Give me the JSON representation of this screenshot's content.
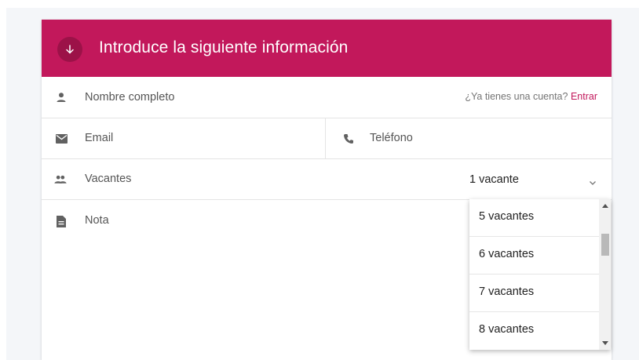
{
  "form": {
    "header_title": "Introduce la siguiente información",
    "header_icon": "arrow-down-icon",
    "accent_color": "#c2185b",
    "name_placeholder": "Nombre completo",
    "login_prompt": "¿Ya tienes una cuenta?",
    "login_link": "Entrar",
    "email_placeholder": "Email",
    "phone_placeholder": "Teléfono",
    "vacancies_label": "Vacantes",
    "vacancies_selected": "1 vacante",
    "note_placeholder": "Nota"
  },
  "dropdown": {
    "options": [
      "5 vacantes",
      "6 vacantes",
      "7 vacantes",
      "8 vacantes"
    ]
  }
}
